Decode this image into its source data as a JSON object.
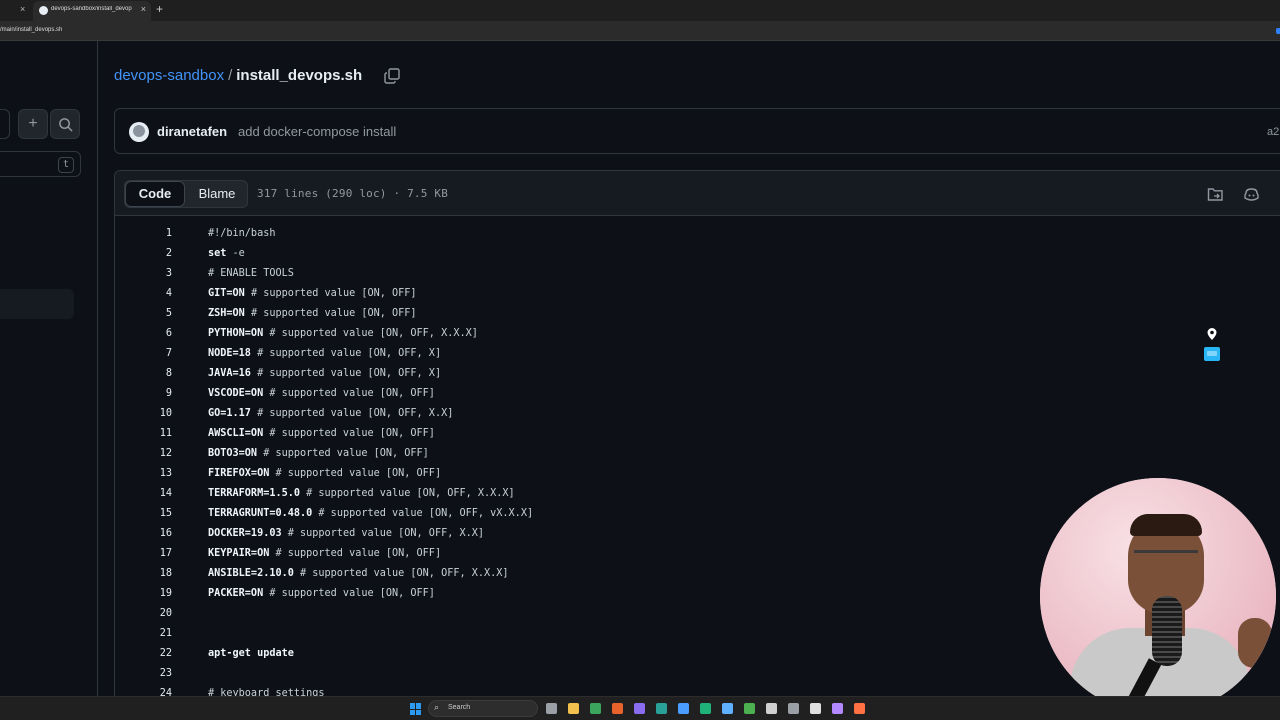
{
  "browser": {
    "tab_title": "devops-sandbox/install_devop",
    "new_tab_glyph": "+",
    "close_glyph": "×",
    "address": "/main/install_devops.sh"
  },
  "sidebar": {
    "add_glyph": "+",
    "shortcut_key": "t"
  },
  "breadcrumb": {
    "repo": "devops-sandbox",
    "separator": "/",
    "file": "install_devops.sh"
  },
  "commit": {
    "author": "diranetafen",
    "message": "add docker-compose install",
    "sha": "a2"
  },
  "file_header": {
    "code_label": "Code",
    "blame_label": "Blame",
    "info": "317 lines (290 loc) · 7.5 KB"
  },
  "code_lines": [
    {
      "n": "1",
      "kw": "",
      "rest": "#!/bin/bash"
    },
    {
      "n": "2",
      "kw": "set",
      "rest": " -e"
    },
    {
      "n": "3",
      "kw": "",
      "rest": "# ENABLE TOOLS"
    },
    {
      "n": "4",
      "kw": "GIT=ON",
      "rest": " # supported value [ON, OFF]"
    },
    {
      "n": "5",
      "kw": "ZSH=ON",
      "rest": " # supported value [ON, OFF]"
    },
    {
      "n": "6",
      "kw": "PYTHON=ON",
      "rest": " # supported value [ON, OFF, X.X.X]"
    },
    {
      "n": "7",
      "kw": "NODE=18",
      "rest": " # supported value [ON, OFF, X]"
    },
    {
      "n": "8",
      "kw": "JAVA=16",
      "rest": " # supported value [ON, OFF, X]"
    },
    {
      "n": "9",
      "kw": "VSCODE=ON",
      "rest": " # supported value [ON, OFF]"
    },
    {
      "n": "10",
      "kw": "GO=1.17",
      "rest": " # supported value [ON, OFF, X.X]"
    },
    {
      "n": "11",
      "kw": "AWSCLI=ON",
      "rest": " # supported value [ON, OFF]"
    },
    {
      "n": "12",
      "kw": "BOTO3=ON",
      "rest": " # supported value [ON, OFF]"
    },
    {
      "n": "13",
      "kw": "FIREFOX=ON",
      "rest": " # supported value [ON, OFF]"
    },
    {
      "n": "14",
      "kw": "TERRAFORM=1.5.0",
      "rest": " # supported value [ON, OFF, X.X.X]"
    },
    {
      "n": "15",
      "kw": "TERRAGRUNT=0.48.0",
      "rest": " # supported value [ON, OFF, vX.X.X]"
    },
    {
      "n": "16",
      "kw": "DOCKER=19.03",
      "rest": " # supported value [ON, OFF, X.X]"
    },
    {
      "n": "17",
      "kw": "KEYPAIR=ON",
      "rest": " # supported value [ON, OFF]"
    },
    {
      "n": "18",
      "kw": "ANSIBLE=2.10.0",
      "rest": " # supported value [ON, OFF, X.X.X]"
    },
    {
      "n": "19",
      "kw": "PACKER=ON",
      "rest": " # supported value [ON, OFF]"
    },
    {
      "n": "20",
      "kw": "",
      "rest": ""
    },
    {
      "n": "21",
      "kw": "",
      "rest": ""
    },
    {
      "n": "22",
      "kw": "apt-get update",
      "rest": ""
    },
    {
      "n": "23",
      "kw": "",
      "rest": ""
    },
    {
      "n": "24",
      "kw": "",
      "rest": "# keyboard settings"
    }
  ],
  "taskbar": {
    "search_label": "Search",
    "icon_colors": [
      "#9aa0a6",
      "#f2c14e",
      "#3ba55d",
      "#e8622c",
      "#8a6cf0",
      "#2aa198",
      "#4a9eff",
      "#1fb37a",
      "#5fb0ff",
      "#4caf50",
      "#d0d0d0",
      "#9aa0a6",
      "#e0e0e0",
      "#b388ff",
      "#ff7043"
    ]
  },
  "colors": {
    "link": "#4493f8",
    "background": "#0d1117",
    "border": "#30363d"
  }
}
